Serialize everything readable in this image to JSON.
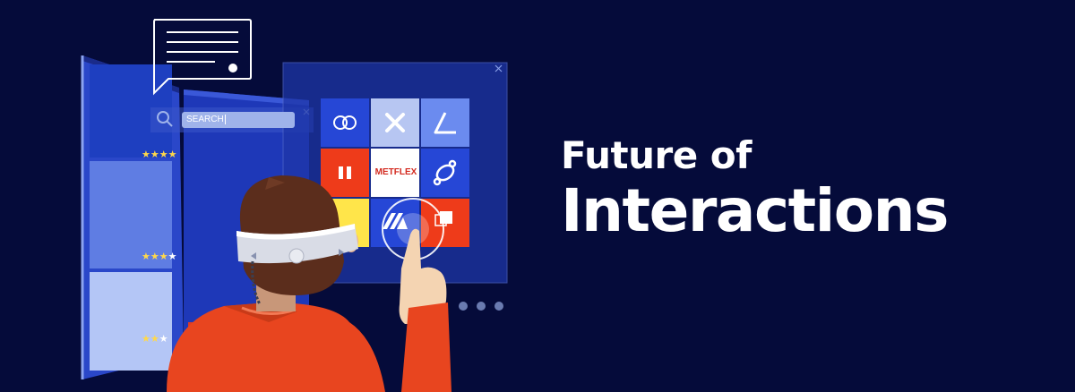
{
  "headline": {
    "line1": "Future of",
    "line2": "Interactions"
  },
  "search": {
    "label": "SEARCH"
  },
  "tiles": {
    "center_label": "METFLEX"
  },
  "colors": {
    "background": "#050b3a",
    "panel_blue": "#2343c4",
    "accent_red": "#ee3b1a",
    "tile_light_blue": "#5d7ef0",
    "tile_yellow": "#ffe54a",
    "star_yellow": "#ffd84a"
  },
  "icons": [
    "chat-bubble-icon",
    "search-icon",
    "close-icon",
    "overlap-circles-icon",
    "x-mark-icon",
    "triangle-icon",
    "pause-icon",
    "satellite-icon",
    "square-icon",
    "star-icon",
    "vr-headset",
    "pointing-hand"
  ],
  "ratings": [
    {
      "stars_filled": 4,
      "stars_total": 4
    },
    {
      "stars_filled": 3,
      "stars_total": 4
    },
    {
      "stars_filled": 2,
      "stars_total": 3
    }
  ]
}
